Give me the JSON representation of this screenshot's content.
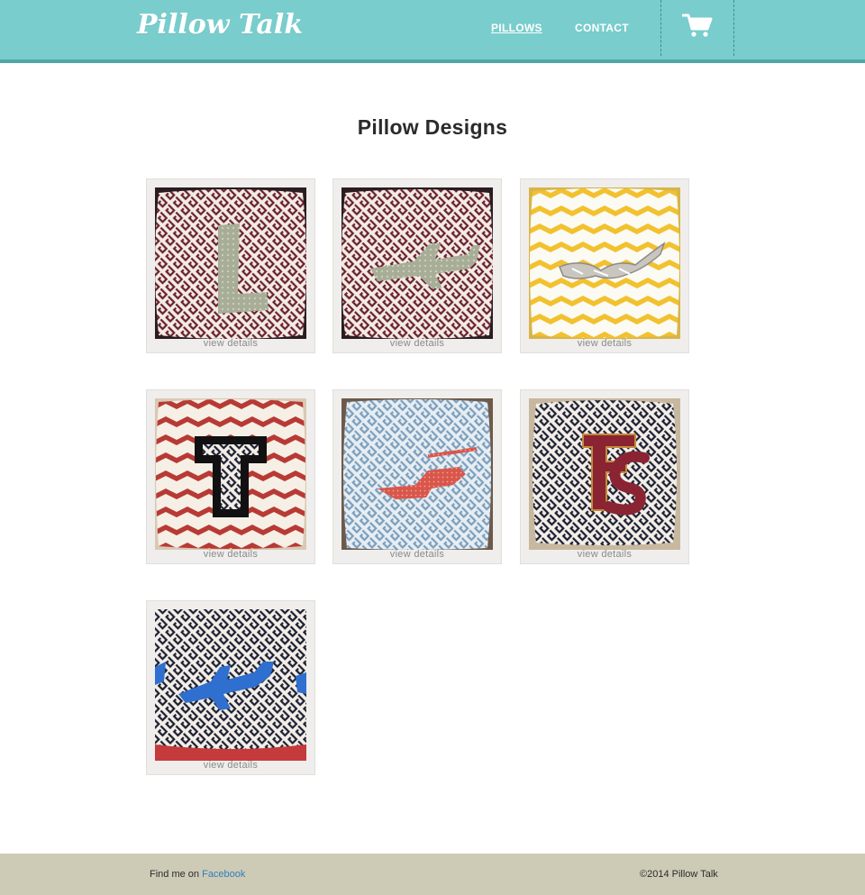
{
  "header": {
    "logo": "Pillow Talk",
    "nav": [
      {
        "label": "PILLOWS",
        "active": true
      },
      {
        "label": "CONTACT",
        "active": false
      }
    ],
    "cart_icon": "shopping-cart-icon",
    "color": "#79cdcc"
  },
  "main": {
    "title": "Pillow Designs",
    "products": [
      {
        "image": "letter-l-pillow",
        "link": "view details"
      },
      {
        "image": "airplane-pillow",
        "link": "view details"
      },
      {
        "image": "yellow-chevron-pillow",
        "link": "view details"
      },
      {
        "image": "texas-tech-pillow",
        "link": "view details"
      },
      {
        "image": "helicopter-pillow",
        "link": "view details"
      },
      {
        "image": "fsu-pillow",
        "link": "view details"
      },
      {
        "image": "blue-plane-pillow",
        "link": "view details"
      }
    ]
  },
  "footer": {
    "find_prefix": "Find me on ",
    "find_link": "Facebook",
    "copyright": "©2014 Pillow Talk",
    "link_color": "#2f7fb8"
  }
}
